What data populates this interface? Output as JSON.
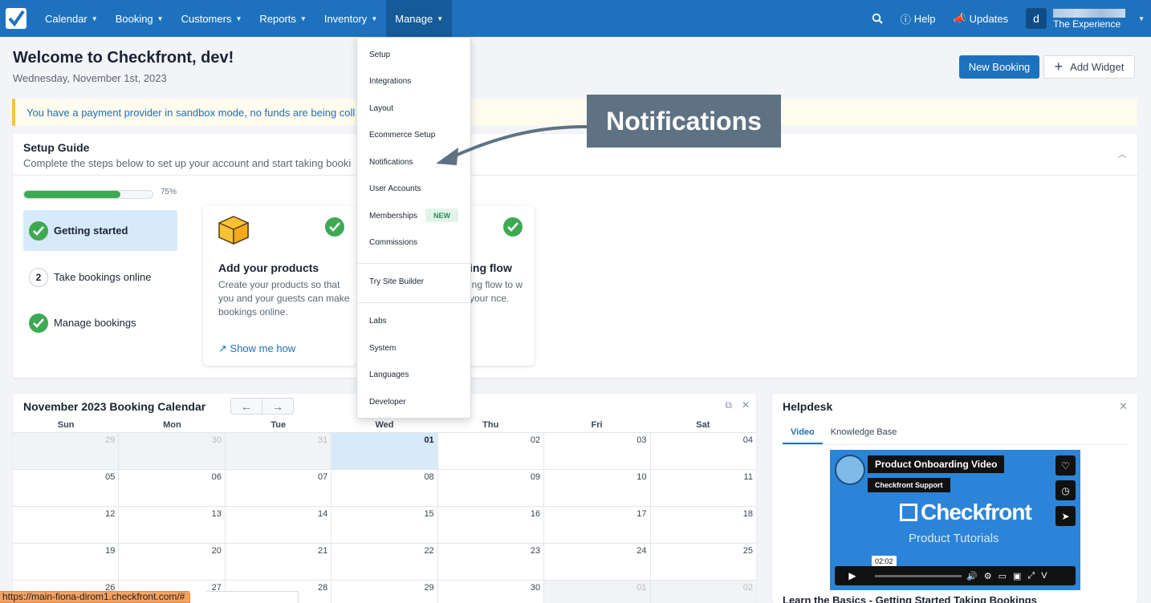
{
  "nav": {
    "items": [
      {
        "label": "Calendar"
      },
      {
        "label": "Booking"
      },
      {
        "label": "Customers"
      },
      {
        "label": "Reports"
      },
      {
        "label": "Inventory"
      },
      {
        "label": "Manage"
      }
    ],
    "help_label": "Help",
    "updates_label": "Updates",
    "avatar_letter": "d",
    "account_name": "The Experience"
  },
  "header": {
    "welcome": "Welcome to Checkfront, dev!",
    "date": "Wednesday, November 1st, 2023",
    "new_booking_label": "New Booking",
    "add_widget_label": "Add Widget"
  },
  "alert": {
    "text": "You have a payment provider in sandbox mode, no funds are being coll"
  },
  "setup": {
    "title": "Setup Guide",
    "subtitle": "Complete the steps below to set up your account and start taking booki",
    "progress_label": "75%",
    "progress_value": 0.75,
    "steps": [
      {
        "label": "Getting started",
        "number": ""
      },
      {
        "label": "Take bookings online",
        "number": "2"
      },
      {
        "label": "Manage bookings",
        "number": ""
      }
    ],
    "tasks": [
      {
        "title": "Add your products",
        "desc": "Create your products so that you and your guests can make bookings online.",
        "link": "Show me how"
      },
      {
        "title": "ing flow",
        "desc": "ing flow to w your nce.",
        "link": ""
      }
    ]
  },
  "manage_menu": {
    "items": [
      "Setup",
      "Integrations",
      "Layout",
      "Ecommerce Setup",
      "Notifications",
      "User Accounts",
      "Memberships",
      "Commissions",
      "Try Site Builder",
      "Labs",
      "System",
      "Languages",
      "Developer"
    ],
    "new_badge": "NEW"
  },
  "callout": {
    "text": "Notifications"
  },
  "calendar": {
    "title": "November 2023 Booking Calendar",
    "days": [
      "Sun",
      "Mon",
      "Tue",
      "Wed",
      "Thu",
      "Fri",
      "Sat"
    ],
    "weeks": [
      [
        "29",
        "30",
        "31",
        "01",
        "02",
        "03",
        "04"
      ],
      [
        "05",
        "06",
        "07",
        "08",
        "09",
        "10",
        "11"
      ],
      [
        "12",
        "13",
        "14",
        "15",
        "16",
        "17",
        "18"
      ],
      [
        "19",
        "20",
        "21",
        "22",
        "23",
        "24",
        "25"
      ],
      [
        "26",
        "27",
        "28",
        "29",
        "30",
        "01",
        "02"
      ]
    ]
  },
  "helpdesk": {
    "title": "Helpdesk",
    "tabs": [
      "Video",
      "Knowledge Base"
    ],
    "video": {
      "title": "Product Onboarding Video",
      "channel": "Checkfront Support",
      "brand": "Checkfront",
      "tagline": "Product Tutorials",
      "time": "02:02"
    },
    "footer": "Learn the Basics - Getting Started Taking Bookings"
  },
  "statusbar": {
    "url": "https://main-fiona-dirom1.checkfront.com/#"
  }
}
